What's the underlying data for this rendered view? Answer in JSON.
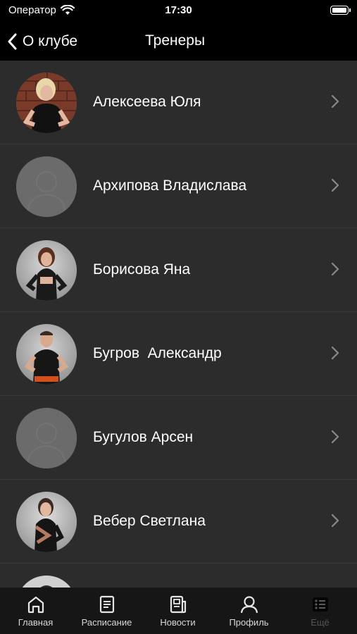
{
  "status_bar": {
    "carrier": "Оператор",
    "time": "17:30"
  },
  "nav": {
    "back_label": "О клубе",
    "title": "Тренеры"
  },
  "trainers": [
    {
      "name": "Алексеева Юля",
      "photo": "photo-woman-brick-wall"
    },
    {
      "name": "Архипова Владислава",
      "photo": "placeholder-person-icon"
    },
    {
      "name": "Борисова Яна",
      "photo": "photo-woman"
    },
    {
      "name": "Бугров  Александр",
      "photo": "photo-man"
    },
    {
      "name": "Бугулов Арсен",
      "photo": "placeholder-person-icon"
    },
    {
      "name": "Вебер Светлана",
      "photo": "photo-woman"
    },
    {
      "name": "",
      "photo": "photo-man-partial"
    }
  ],
  "tab_bar": {
    "tabs": [
      {
        "label": "Главная",
        "icon": "home-icon",
        "active": false
      },
      {
        "label": "Расписание",
        "icon": "schedule-icon",
        "active": false
      },
      {
        "label": "Новости",
        "icon": "news-icon",
        "active": false
      },
      {
        "label": "Профиль",
        "icon": "profile-icon",
        "active": false
      },
      {
        "label": "Ещё",
        "icon": "more-icon",
        "active": true
      }
    ]
  },
  "colors": {
    "background": "#000000",
    "list_background": "#2c2c2c",
    "divider": "#3a3a3a",
    "tab_bar": "#161616",
    "chevron": "#8a8a8a",
    "placeholder_avatar": "#6b6b6b"
  }
}
